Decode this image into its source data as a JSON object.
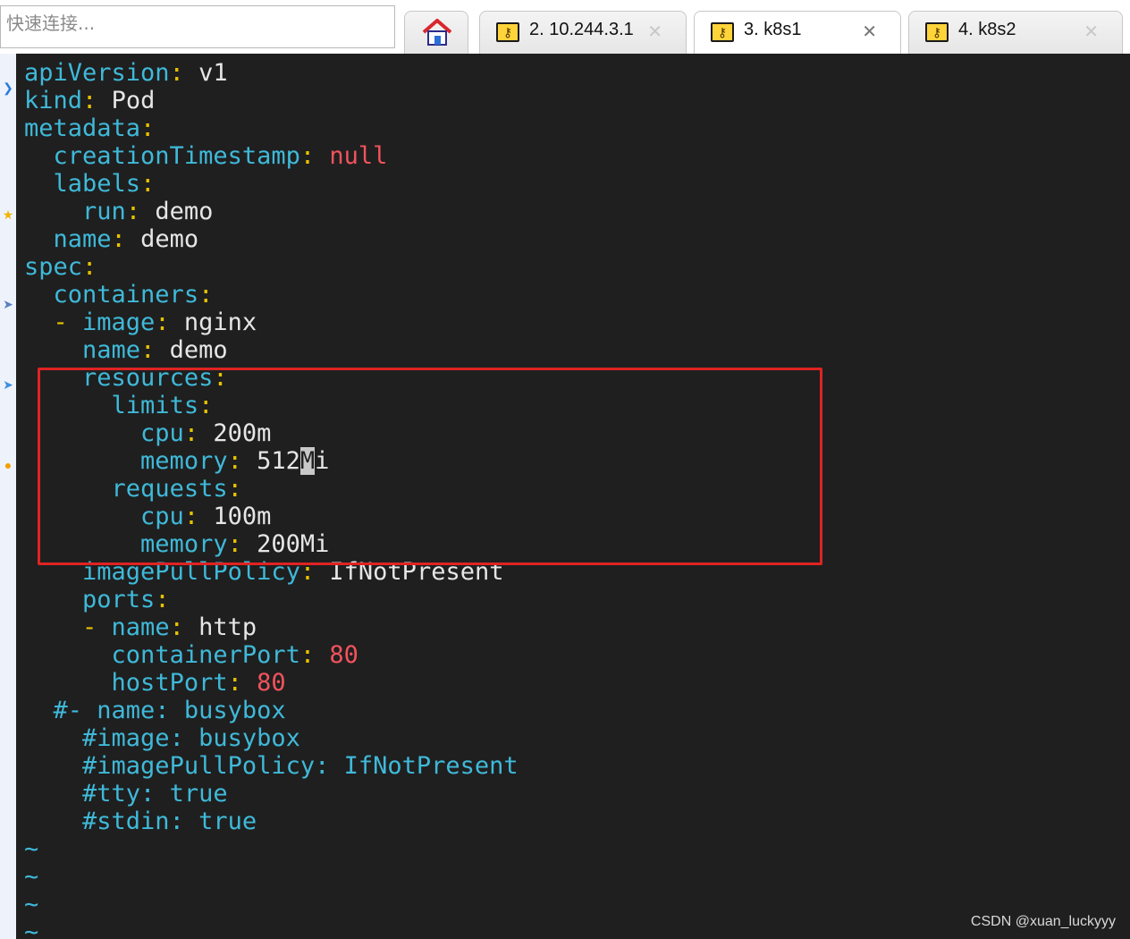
{
  "quick_connect": {
    "placeholder": "快速连接..."
  },
  "tabs": [
    {
      "label": "",
      "icon": "home-icon",
      "active": false
    },
    {
      "label": "2. 10.244.3.1",
      "icon": "key-icon",
      "active": false,
      "close": "✕"
    },
    {
      "label": "3. k8s1",
      "icon": "key-icon",
      "active": true,
      "close": "✕"
    },
    {
      "label": "4. k8s2",
      "icon": "key-icon",
      "active": false,
      "close": "✕"
    }
  ],
  "terminal": {
    "lines": [
      {
        "indent": "",
        "key": "apiVersion",
        "value": "v1",
        "vtype": "s"
      },
      {
        "indent": "",
        "key": "kind",
        "value": "Pod",
        "vtype": "s"
      },
      {
        "indent": "",
        "key": "metadata",
        "value": "",
        "vtype": "s"
      },
      {
        "indent": "  ",
        "key": "creationTimestamp",
        "value": "null",
        "vtype": "n"
      },
      {
        "indent": "  ",
        "key": "labels",
        "value": "",
        "vtype": "s"
      },
      {
        "indent": "    ",
        "key": "run",
        "value": "demo",
        "vtype": "s"
      },
      {
        "indent": "  ",
        "key": "name",
        "value": "demo",
        "vtype": "s"
      },
      {
        "indent": "",
        "key": "spec",
        "value": "",
        "vtype": "s"
      },
      {
        "indent": "  ",
        "key": "containers",
        "value": "",
        "vtype": "s"
      },
      {
        "indent": "  ",
        "dash": "- ",
        "key": "image",
        "value": "nginx",
        "vtype": "s"
      },
      {
        "indent": "    ",
        "key": "name",
        "value": "demo",
        "vtype": "s"
      },
      {
        "indent": "    ",
        "key": "resources",
        "value": "",
        "vtype": "s"
      },
      {
        "indent": "      ",
        "key": "limits",
        "value": "",
        "vtype": "s"
      },
      {
        "indent": "        ",
        "key": "cpu",
        "value": "200m",
        "vtype": "s"
      },
      {
        "indent": "        ",
        "key": "memory",
        "value": "512",
        "cursor": "M",
        "after": "i",
        "vtype": "s"
      },
      {
        "indent": "      ",
        "key": "requests",
        "value": "",
        "vtype": "s"
      },
      {
        "indent": "        ",
        "key": "cpu",
        "value": "100m",
        "vtype": "s"
      },
      {
        "indent": "        ",
        "key": "memory",
        "value": "200Mi",
        "vtype": "s"
      },
      {
        "indent": "    ",
        "key": "imagePullPolicy",
        "value": "IfNotPresent",
        "vtype": "s"
      },
      {
        "indent": "    ",
        "key": "ports",
        "value": "",
        "vtype": "s"
      },
      {
        "indent": "    ",
        "dash": "- ",
        "key": "name",
        "value": "http",
        "vtype": "s"
      },
      {
        "indent": "      ",
        "key": "containerPort",
        "value": "80",
        "vtype": "n"
      },
      {
        "indent": "      ",
        "key": "hostPort",
        "value": "80",
        "vtype": "n"
      },
      {
        "indent": "  ",
        "comment": "#- name: busybox"
      },
      {
        "indent": "    ",
        "comment": "#image: busybox"
      },
      {
        "indent": "    ",
        "comment": "#imagePullPolicy: IfNotPresent"
      },
      {
        "indent": "    ",
        "comment": "#tty: true"
      },
      {
        "indent": "    ",
        "comment": "#stdin: true"
      },
      {
        "tilde": "~"
      },
      {
        "tilde": "~"
      },
      {
        "tilde": "~"
      },
      {
        "tilde": "~"
      }
    ]
  },
  "watermark": "CSDN @xuan_luckyyy",
  "colors": {
    "terminal_bg": "#1f1f1f",
    "key": "#3fb9d9",
    "punct": "#e6c200",
    "number": "#f2535d",
    "highlight_box": "#e02323"
  }
}
